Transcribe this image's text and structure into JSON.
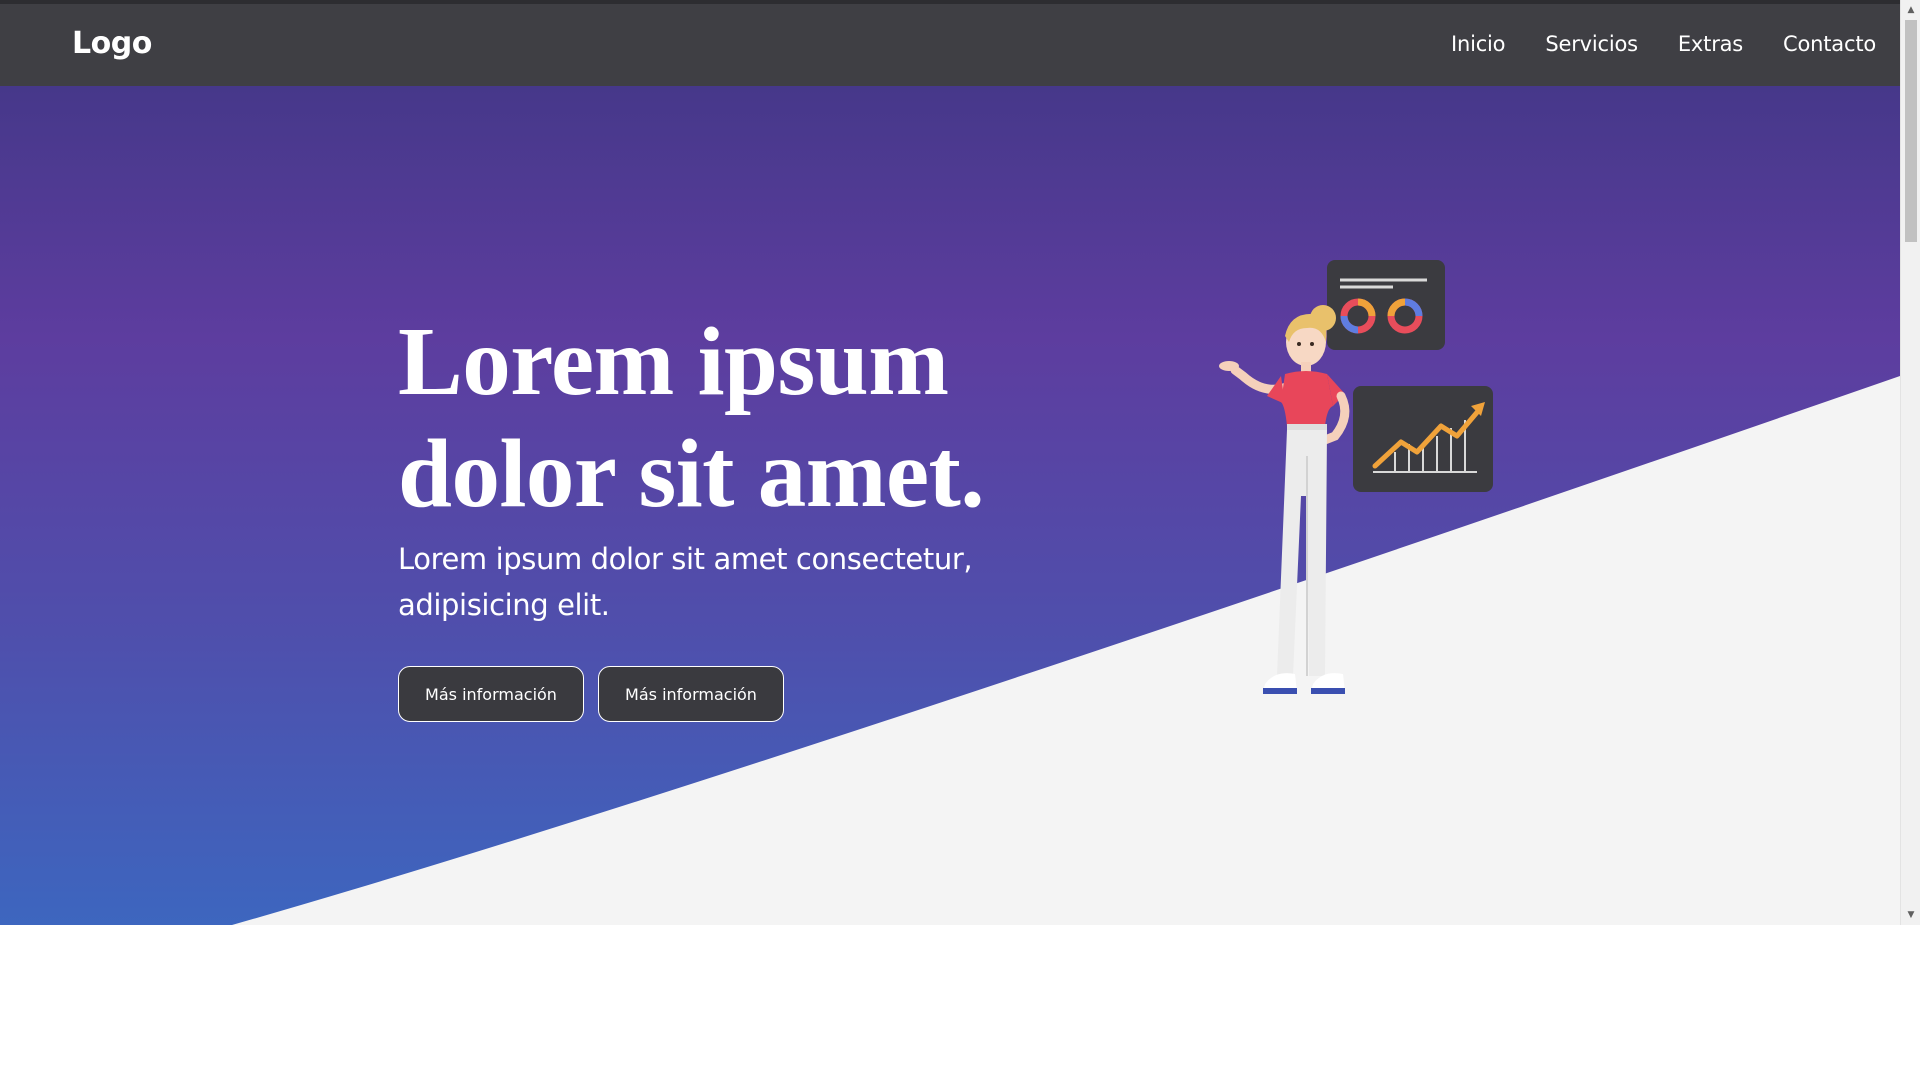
{
  "navbar": {
    "logo": "Logo",
    "links": [
      "Inicio",
      "Servicios",
      "Extras",
      "Contacto"
    ]
  },
  "hero": {
    "title": "Lorem ipsum dolor sit amet.",
    "subtitle": "Lorem ipsum dolor sit amet consectetur, adipisicing elit.",
    "buttons": [
      "Más información",
      "Más información"
    ]
  },
  "colors": {
    "navbar": "#3f3f44",
    "gradient_top": "#463a8c",
    "gradient_mid": "#5b3ea0",
    "gradient_bottom": "#3f64bd",
    "wedge": "#f4f4f4",
    "button_bg": "#3a3a3f"
  },
  "icons": {
    "illustration": "woman-presenting-charts-illustration",
    "scroll_up": "scroll-up-arrow-icon",
    "scroll_down": "scroll-down-arrow-icon"
  }
}
